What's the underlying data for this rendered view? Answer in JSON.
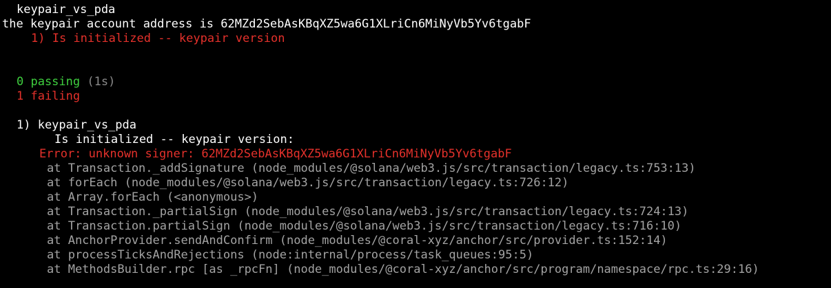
{
  "terminal": {
    "colors": {
      "background": "#000000",
      "text": "#ffffff",
      "error": "#e5312b",
      "passing": "#3fcf3f",
      "muted": "#8a8a8a",
      "stack": "#a3a3a3"
    },
    "suite_title": "keypair_vs_pda",
    "log_line": "the keypair account address is 62MZd2SebAsKBqXZ5wa6G1XLriCn6MiNyVb5Yv6tgabF",
    "failed_test_line": "1) Is initialized -- keypair version",
    "summary": {
      "passing": "0 passing",
      "duration": "(1s)",
      "failing": "1 failing"
    },
    "failure": {
      "header": "1) keypair_vs_pda",
      "test_name": "Is initialized -- keypair version:",
      "error": "Error: unknown signer: 62MZd2SebAsKBqXZ5wa6G1XLriCn6MiNyVb5Yv6tgabF",
      "stack": [
        "at Transaction._addSignature (node_modules/@solana/web3.js/src/transaction/legacy.ts:753:13)",
        "at forEach (node_modules/@solana/web3.js/src/transaction/legacy.ts:726:12)",
        "at Array.forEach (<anonymous>)",
        "at Transaction._partialSign (node_modules/@solana/web3.js/src/transaction/legacy.ts:724:13)",
        "at Transaction.partialSign (node_modules/@solana/web3.js/src/transaction/legacy.ts:716:10)",
        "at AnchorProvider.sendAndConfirm (node_modules/@coral-xyz/anchor/src/provider.ts:152:14)",
        "at processTicksAndRejections (node:internal/process/task_queues:95:5)",
        "at MethodsBuilder.rpc [as _rpcFn] (node_modules/@coral-xyz/anchor/src/program/namespace/rpc.ts:29:16)"
      ]
    }
  }
}
